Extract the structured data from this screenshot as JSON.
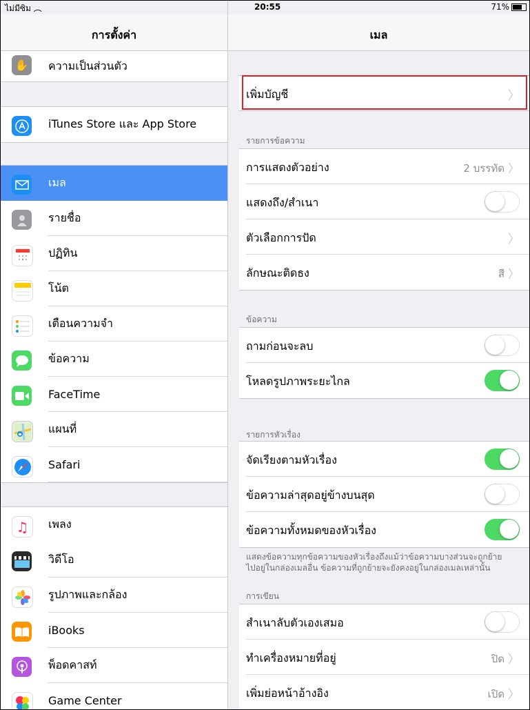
{
  "status": {
    "carrier": "ไม่มีซิม",
    "time": "20:55",
    "battery": "71%"
  },
  "left": {
    "title": "การตั้งค่า",
    "groups": [
      [
        {
          "label": "ความเป็นส่วนตัว",
          "icon": "hand-icon",
          "color": "#8e8e93"
        }
      ],
      [
        {
          "label": "iTunes Store และ App Store",
          "icon": "app-store-icon",
          "color": "#1d8ef3"
        }
      ],
      [
        {
          "label": "เมล",
          "icon": "mail-icon",
          "color": "#1d8ef3"
        },
        {
          "label": "รายชื่อ",
          "icon": "contacts-icon",
          "color": "#8e8e93"
        },
        {
          "label": "ปฏิทิน",
          "icon": "calendar-icon",
          "color": "#ffffff"
        },
        {
          "label": "โน้ต",
          "icon": "notes-icon",
          "color": "#ffcc00"
        },
        {
          "label": "เตือนความจำ",
          "icon": "reminders-icon",
          "color": "#ffffff"
        },
        {
          "label": "ข้อความ",
          "icon": "messages-icon",
          "color": "#4cd964"
        },
        {
          "label": "FaceTime",
          "icon": "facetime-icon",
          "color": "#4cd964"
        },
        {
          "label": "แผนที่",
          "icon": "maps-icon",
          "color": "#6bb4f5"
        },
        {
          "label": "Safari",
          "icon": "safari-icon",
          "color": "#1d8ef3"
        }
      ],
      [
        {
          "label": "เพลง",
          "icon": "music-icon",
          "color": "#ffffff"
        },
        {
          "label": "วิดีโอ",
          "icon": "videos-icon",
          "color": "#222222"
        },
        {
          "label": "รูปภาพและกล้อง",
          "icon": "photos-icon",
          "color": "#ffffff"
        },
        {
          "label": "iBooks",
          "icon": "ibooks-icon",
          "color": "#ff9500"
        },
        {
          "label": "พ็อดคาสท์",
          "icon": "podcasts-icon",
          "color": "#b455e0"
        },
        {
          "label": "Game Center",
          "icon": "game-center-icon",
          "color": "#ffffff"
        }
      ]
    ],
    "selected": "เมล",
    "accent": "#4a90f5"
  },
  "right": {
    "title": "เมล",
    "add_account": "เพิ่มบัญชี",
    "sections": {
      "message_list": {
        "header": "รายการข้อความ",
        "preview": {
          "label": "การแสดงตัวอย่าง",
          "value": "2 บรรทัด"
        },
        "show_to_cc": {
          "label": "แสดงถึง/สำเนา",
          "on": false
        },
        "swipe_options": {
          "label": "ตัวเลือกการปัด"
        },
        "flag_style": {
          "label": "ลักษณะติดธง",
          "value": "สี"
        }
      },
      "messages": {
        "header": "ข้อความ",
        "ask_before_deleting": {
          "label": "ถามก่อนจะลบ",
          "on": false
        },
        "load_remote_images": {
          "label": "โหลดรูปภาพระยะไกล",
          "on": true
        }
      },
      "threading": {
        "header": "รายการหัวเรื่อง",
        "organize_by_thread": {
          "label": "จัดเรียงตามหัวเรื่อง",
          "on": true
        },
        "most_recent_on_top": {
          "label": "ข้อความล่าสุดอยู่ข้างบนสุด",
          "on": false
        },
        "complete_threads": {
          "label": "ข้อความทั้งหมดของหัวเรื่อง",
          "on": true
        },
        "footer_line1": "แสดงข้อความทุกข้อความของหัวเรื่องถึงแม้ว่าข้อความบางส่วนจะถูกย้าย",
        "footer_line2": "ไปอยู่ในกล่องเมลอื่น ข้อความที่ถูกย้ายจะยังคงอยู่ในกล่องเมลเหล่านั้น"
      },
      "composing": {
        "header": "การเขียน",
        "always_bcc_myself": {
          "label": "สำเนาลับตัวเองเสมอ",
          "on": false
        },
        "mark_addresses": {
          "label": "ทำเครื่องหมายที่อยู่",
          "value": "ปิด"
        },
        "increase_quote_level": {
          "label": "เพิ่มย่อหน้าอ้างอิง",
          "value": "เปิด"
        }
      }
    },
    "toggle_on_color": "#4cd964",
    "highlight_color": "#e31e24"
  }
}
